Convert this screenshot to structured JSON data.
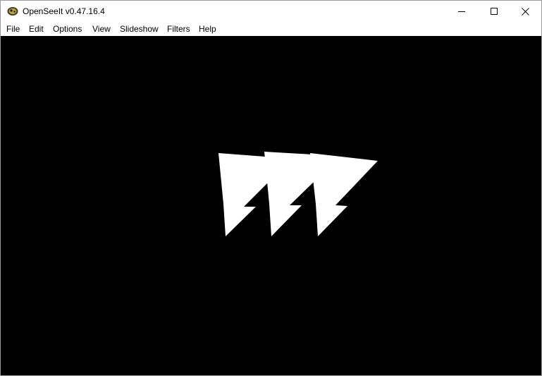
{
  "window": {
    "title": "OpenSeeIt v0.47.16.4",
    "app_icon": "openseeit-app-icon",
    "controls": {
      "minimize_icon": "minimize-icon",
      "maximize_icon": "maximize-icon",
      "close_icon": "close-icon"
    }
  },
  "menu": {
    "items": [
      {
        "label": "File"
      },
      {
        "label": "Edit"
      },
      {
        "label": "Options"
      },
      {
        "label": "View"
      },
      {
        "label": "Slideshow"
      },
      {
        "label": "Filters"
      },
      {
        "label": "Help"
      }
    ]
  },
  "viewer": {
    "background": "#000000",
    "image": {
      "description_icon": "white-lightning-triangles-image",
      "foreground": "#ffffff",
      "shape_count": 3
    }
  }
}
